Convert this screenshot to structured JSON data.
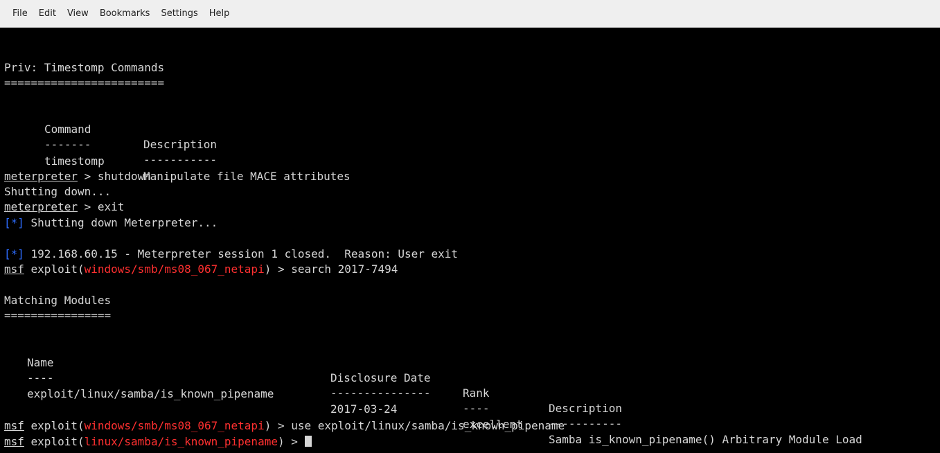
{
  "menu": [
    "File",
    "Edit",
    "View",
    "Bookmarks",
    "Settings",
    "Help"
  ],
  "terminal": {
    "section1_title": "Priv: Timestomp Commands",
    "section1_rule": "========================",
    "cmd_table": {
      "headers": [
        "Command",
        "Description"
      ],
      "rules": [
        "-------",
        "-----------"
      ],
      "rows": [
        [
          "timestomp",
          "Manipulate file MACE attributes"
        ]
      ]
    },
    "l1_prompt": "meterpreter",
    "l1_rest": " > shutdown",
    "l2": "Shutting down...",
    "l3_prompt": "meterpreter",
    "l3_rest": " > exit",
    "l4_tag": "[*]",
    "l4_rest": " Shutting down Meterpreter...",
    "l5_tag": "[*]",
    "l5_rest": " 192.168.60.15 - Meterpreter session 1 closed.  Reason: User exit",
    "l6_msf": "msf",
    "l6_a": " exploit(",
    "l6_mod": "windows/smb/ms08_067_netapi",
    "l6_b": ") > search 2017-7494",
    "section2_title": "Matching Modules",
    "section2_rule": "================",
    "mod_table": {
      "headers": [
        "Name",
        "Disclosure Date",
        "Rank",
        "Description"
      ],
      "rules": [
        "----",
        "---------------",
        "----",
        "-----------"
      ],
      "rows": [
        [
          "exploit/linux/samba/is_known_pipename",
          "2017-03-24",
          "excellent",
          "Samba is_known_pipename() Arbitrary Module Load"
        ]
      ]
    },
    "l7_msf": "msf",
    "l7_a": " exploit(",
    "l7_mod": "windows/smb/ms08_067_netapi",
    "l7_b": ") > use exploit/linux/samba/is_known_pipename",
    "l8_msf": "msf",
    "l8_a": " exploit(",
    "l8_mod": "linux/samba/is_known_pipename",
    "l8_b": ") > "
  },
  "colors": {
    "prompt_red": "#ff3030",
    "info_blue": "#2d6cff",
    "text": "#d6d6d6",
    "background": "#000000"
  }
}
